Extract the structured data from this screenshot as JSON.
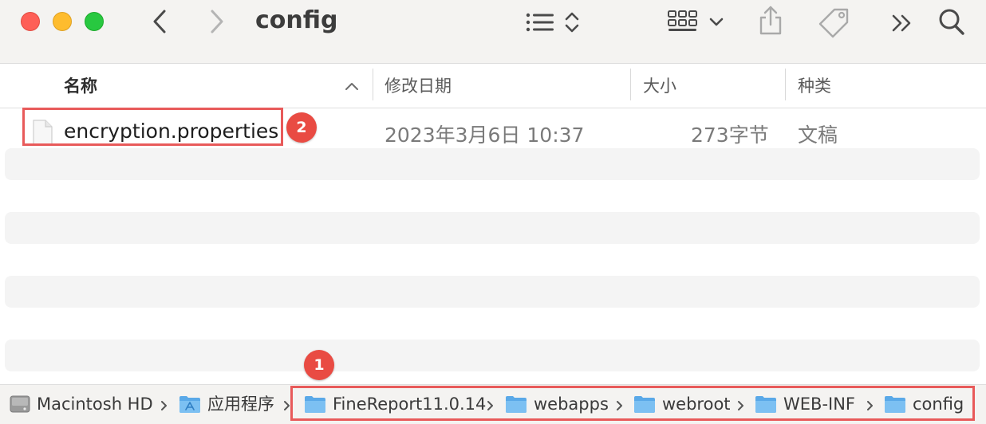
{
  "window": {
    "title": "config"
  },
  "toolbar": {
    "icons": [
      "back-arrow-icon",
      "forward-arrow-icon",
      "list-view-icon",
      "sort-toggle-icon",
      "grid-view-icon",
      "chevron-down-icon",
      "share-icon",
      "tag-icon",
      "more-icon",
      "search-icon"
    ]
  },
  "columns": {
    "name": "名称",
    "date": "修改日期",
    "size": "大小",
    "kind": "种类"
  },
  "files": [
    {
      "name": "encryption.properties",
      "modified": "2023年3月6日 10:37",
      "size": "273字节",
      "kind": "文稿",
      "icon": "document-icon"
    }
  ],
  "annotations": {
    "badge_1": "1",
    "badge_2": "2"
  },
  "pathbar": {
    "items": [
      {
        "label": "Macintosh HD",
        "icon": "disk-icon"
      },
      {
        "label": "应用程序",
        "icon": "applications-folder-icon"
      },
      {
        "label": "FineReport11.0.14",
        "icon": "folder-icon"
      },
      {
        "label": "webapps",
        "icon": "folder-icon"
      },
      {
        "label": "webroot",
        "icon": "folder-icon"
      },
      {
        "label": "WEB-INF",
        "icon": "folder-icon"
      },
      {
        "label": "config",
        "icon": "folder-icon"
      }
    ]
  },
  "colors": {
    "highlight": "#e85a5a",
    "badge": "#e94b43",
    "folder": "#5aa9e8"
  }
}
